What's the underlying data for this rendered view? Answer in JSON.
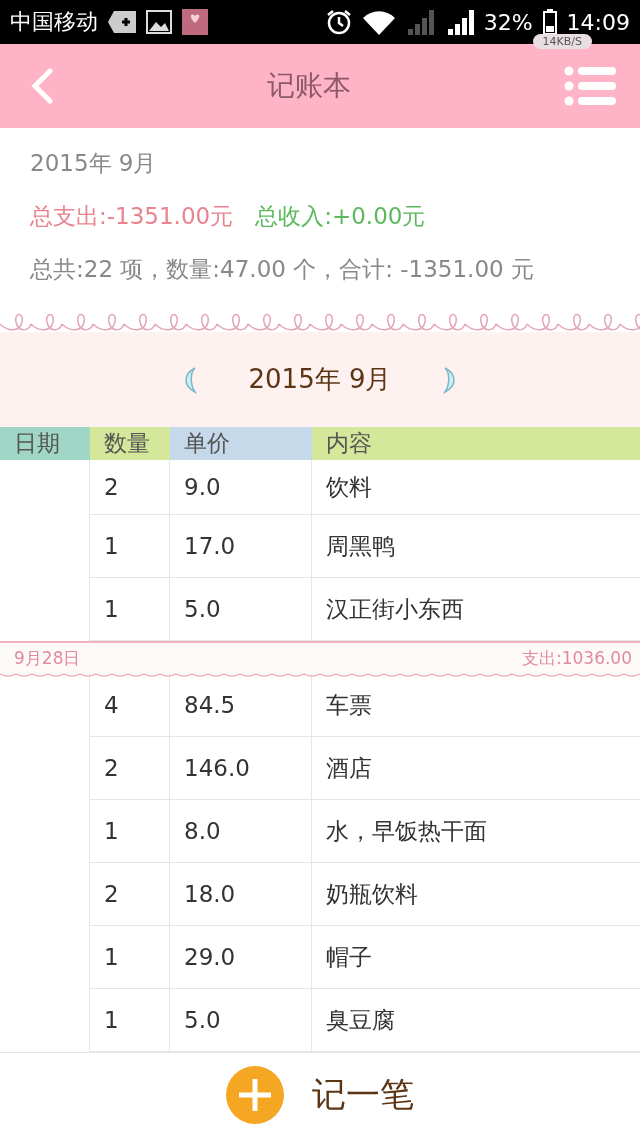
{
  "status_bar": {
    "carrier": "中国移动",
    "battery": "32%",
    "time": "14:09",
    "net_speed": "14KB/S"
  },
  "header": {
    "title": "记账本"
  },
  "summary": {
    "month": "2015年 9月",
    "expense": "总支出:-1351.00元",
    "income": "总收入:+0.00元",
    "totals": "总共:22 项，数量:47.00 个，合计: -1351.00 元"
  },
  "month_nav": {
    "label": "2015年 9月"
  },
  "table": {
    "columns": [
      {
        "label": "日期",
        "color": "#9fd6c5"
      },
      {
        "label": "数量",
        "color": "#d4e79a"
      },
      {
        "label": "单价",
        "color": "#c6d9ea"
      },
      {
        "label": "内容",
        "color": "#d4e79a"
      }
    ],
    "groups": [
      {
        "rows": [
          {
            "qty": "2",
            "price": "9.0",
            "content": "饮料"
          },
          {
            "qty": "1",
            "price": "17.0",
            "content": "周黑鸭"
          },
          {
            "qty": "1",
            "price": "5.0",
            "content": "汉正街小东西"
          }
        ]
      },
      {
        "date": "9月28日",
        "total": "支出:1036.00",
        "rows": [
          {
            "qty": "4",
            "price": "84.5",
            "content": "车票"
          },
          {
            "qty": "2",
            "price": "146.0",
            "content": "酒店"
          },
          {
            "qty": "1",
            "price": "8.0",
            "content": "水，早饭热干面"
          },
          {
            "qty": "2",
            "price": "18.0",
            "content": "奶瓶饮料"
          },
          {
            "qty": "1",
            "price": "29.0",
            "content": "帽子"
          },
          {
            "qty": "1",
            "price": "5.0",
            "content": "臭豆腐"
          }
        ]
      }
    ]
  },
  "add_button": {
    "label": "记一笔"
  }
}
